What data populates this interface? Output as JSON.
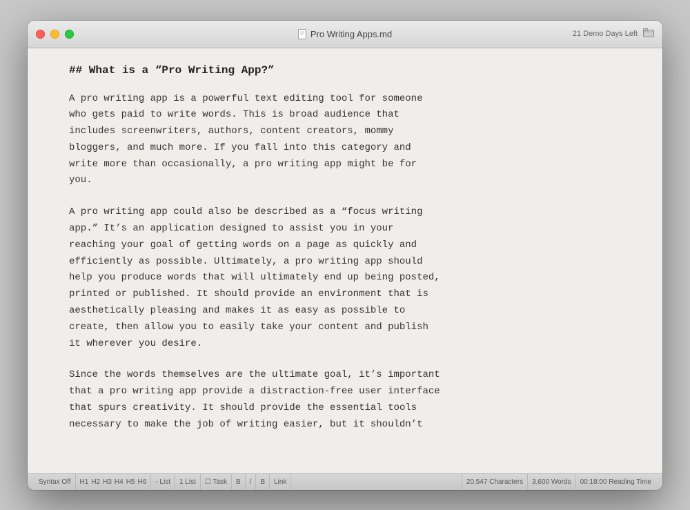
{
  "window": {
    "title": "Pro Writing Apps.md",
    "demo_badge": "21 Demo Days Left"
  },
  "content": {
    "heading": "## What is a “Pro Writing App?”",
    "paragraphs": [
      "A pro writing app is a powerful text editing tool for someone\nwho gets paid to write words. This is broad audience that\nincludes screenwriters, authors, content creators, mommy\nbloggers, and much more. If you fall into this category and\nwrite more than occasionally, a pro writing app might be for\nyou.",
      "A pro writing app could also be described as a “focus writing\napp.” It’s an application designed to assist you in your\nreaching your goal of getting words on a page as quickly and\nefficiently as possible. Ultimately, a pro writing app should\nhelp you produce words that will ultimately end up being posted,\nprinted or published. It should provide an environment that is\naesthetically pleasing and makes it as easy as possible to\ncreate, then allow you to easily take your content and publish\nit wherever you desire.",
      "Since the words themselves are the ultimate goal, it’s important\nthat a pro writing app provide a distraction-free user interface\nthat spurs creativity. It should provide the essential tools\nnecessary to make the job of writing easier, but it shouldn’t"
    ]
  },
  "status_bar": {
    "syntax": "Syntax Off",
    "headings": [
      "H1",
      "H2",
      "H3",
      "H4",
      "H5",
      "H6"
    ],
    "list": "- List",
    "numbered_list": "1 List",
    "task": "☐ Task",
    "bold": "B",
    "italic": "/",
    "strikethrough": "B",
    "link": "Link",
    "characters": "20,547 Characters",
    "words": "3,600 Words",
    "reading_time": "00:18:00 Reading Time"
  },
  "icons": {
    "document": "📄",
    "folder": "🗂"
  }
}
